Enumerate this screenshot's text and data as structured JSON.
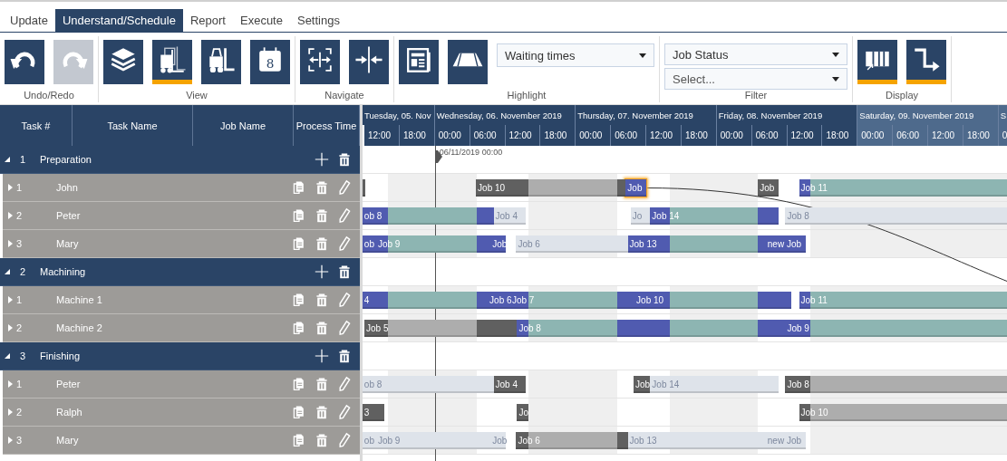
{
  "tabs": [
    {
      "label": "Update",
      "selected": false
    },
    {
      "label": "Understand/Schedule",
      "selected": true
    },
    {
      "label": "Report",
      "selected": false
    },
    {
      "label": "Execute",
      "selected": false
    },
    {
      "label": "Settings",
      "selected": false
    }
  ],
  "ribbon": [
    {
      "label": "Undo/Redo",
      "buttons": [
        {
          "selected": false,
          "disabled": false
        },
        {
          "selected": false,
          "disabled": true
        }
      ]
    },
    {
      "label": "View",
      "buttons": [
        {
          "selected": false,
          "disabled": false
        },
        {
          "selected": true,
          "disabled": false
        },
        {
          "selected": false,
          "disabled": false
        },
        {
          "selected": false,
          "disabled": false,
          "text": "8"
        }
      ]
    },
    {
      "label": "Navigate",
      "buttons": [
        {
          "selected": false,
          "disabled": false
        },
        {
          "selected": false,
          "disabled": false
        }
      ]
    },
    {
      "label": "Highlight",
      "buttons": [
        {
          "selected": false,
          "disabled": false
        },
        {
          "selected": false,
          "disabled": false
        }
      ],
      "dropdowns": [
        {
          "value": "Waiting times"
        }
      ]
    },
    {
      "label": "Filter",
      "dropdowns": [
        {
          "value": "Job Status"
        },
        {
          "placeholder": "Select..."
        }
      ]
    },
    {
      "label": "Display",
      "buttons": [
        {
          "selected": true,
          "disabled": false
        },
        {
          "selected": true,
          "disabled": false
        }
      ]
    }
  ],
  "columns": [
    "Task #",
    "Task Name",
    "Job Name",
    "Process Time"
  ],
  "timeline": {
    "days": [
      {
        "label": "Tuesday, 05. Nov",
        "weekend": false,
        "ticks": [
          "12:00",
          "18:00"
        ]
      },
      {
        "label": "Wednesday, 06. November 2019",
        "weekend": false,
        "ticks": [
          "00:00",
          "06:00",
          "12:00",
          "18:00"
        ]
      },
      {
        "label": "Thursday, 07. November 2019",
        "weekend": false,
        "ticks": [
          "00:00",
          "06:00",
          "12:00",
          "18:00"
        ]
      },
      {
        "label": "Friday, 08. November 2019",
        "weekend": false,
        "ticks": [
          "00:00",
          "06:00",
          "12:00",
          "18:00"
        ]
      },
      {
        "label": "Saturday, 09. November 2019",
        "weekend": true,
        "ticks": [
          "00:00",
          "06:00",
          "12:00",
          "18:00"
        ]
      },
      {
        "label": "S",
        "weekend": true,
        "ticks": [
          "0"
        ]
      }
    ],
    "now_marker": {
      "label": "06/11/2019 00:00"
    }
  },
  "groups": [
    {
      "number": "1",
      "name": "Preparation",
      "expanded": true,
      "children": [
        {
          "number": "1",
          "name": "John",
          "expanded": false,
          "bars": [
            {
              "selected": false,
              "segments": [
                {
                  "kind": "done-setup"
                }
              ]
            },
            {
              "label": "Job 10",
              "selected": false,
              "segments": [
                {
                  "kind": "done-setup"
                },
                {
                  "kind": "done-process"
                },
                {
                  "kind": "done-setup"
                }
              ]
            },
            {
              "label": "Job",
              "selected": true,
              "successor_link": true,
              "segments": [
                {
                  "kind": "setup"
                }
              ]
            },
            {
              "label": "Job",
              "selected": false,
              "segments": [
                {
                  "kind": "done-setup"
                }
              ]
            },
            {
              "label": "Job 11",
              "selected": false,
              "segments": [
                {
                  "kind": "setup"
                },
                {
                  "kind": "process"
                }
              ]
            }
          ]
        },
        {
          "number": "2",
          "name": "Peter",
          "expanded": false,
          "bars": [
            {
              "label": "ob 8",
              "selected": false,
              "segments": [
                {
                  "kind": "setup"
                },
                {
                  "kind": "process"
                },
                {
                  "kind": "setup"
                }
              ]
            },
            {
              "label": "Job 4",
              "selected": false,
              "segments": [
                {
                  "kind": "faded"
                }
              ]
            },
            {
              "label": "Jo",
              "selected": false,
              "segments": [
                {
                  "kind": "faded"
                }
              ]
            },
            {
              "label": "Job 14",
              "selected": false,
              "segments": [
                {
                  "kind": "setup"
                },
                {
                  "kind": "process"
                },
                {
                  "kind": "setup"
                }
              ]
            },
            {
              "label": "Job 8",
              "selected": false,
              "segments": [
                {
                  "kind": "faded"
                }
              ]
            }
          ]
        },
        {
          "number": "3",
          "name": "Mary",
          "expanded": false,
          "bars": [
            {
              "label": "ob",
              "selected": false,
              "segments": [
                {
                  "kind": "setup"
                }
              ]
            },
            {
              "label": "Job 9",
              "selected": false,
              "segments": [
                {
                  "kind": "setup"
                },
                {
                  "kind": "process"
                },
                {
                  "kind": "setup"
                }
              ]
            },
            {
              "label": "Job",
              "selected": false,
              "segments": [
                {
                  "kind": "setup"
                }
              ]
            },
            {
              "label": "Job 6",
              "selected": false,
              "segments": [
                {
                  "kind": "faded"
                }
              ]
            },
            {
              "label": "Job 13",
              "selected": false,
              "segments": [
                {
                  "kind": "setup"
                },
                {
                  "kind": "process"
                },
                {
                  "kind": "setup"
                }
              ]
            },
            {
              "label": "new Job",
              "selected": false,
              "segments": [
                {
                  "kind": "setup"
                }
              ]
            }
          ]
        }
      ]
    },
    {
      "number": "2",
      "name": "Machining",
      "expanded": true,
      "children": [
        {
          "number": "1",
          "name": "Machine 1",
          "expanded": false,
          "bars": [
            {
              "label": "4",
              "selected": false,
              "segments": [
                {
                  "kind": "setup"
                },
                {
                  "kind": "process"
                },
                {
                  "kind": "setup"
                }
              ]
            },
            {
              "label": "Job 6",
              "selected": false,
              "segments": [
                {
                  "kind": "setup"
                }
              ]
            },
            {
              "label": "Job 7",
              "selected": false,
              "segments": [
                {
                  "kind": "setup"
                },
                {
                  "kind": "process"
                },
                {
                  "kind": "setup"
                }
              ]
            },
            {
              "label": "Job 10",
              "selected": false,
              "segments": [
                {
                  "kind": "setup"
                },
                {
                  "kind": "process"
                },
                {
                  "kind": "setup"
                }
              ]
            },
            {
              "label": "Job 11",
              "selected": false,
              "segments": [
                {
                  "kind": "setup"
                },
                {
                  "kind": "process"
                }
              ]
            }
          ]
        },
        {
          "number": "2",
          "name": "Machine 2",
          "expanded": false,
          "bars": [
            {
              "label": "Job 5",
              "selected": false,
              "segments": [
                {
                  "kind": "done-setup"
                },
                {
                  "kind": "done-process"
                },
                {
                  "kind": "done-setup"
                }
              ]
            },
            {
              "label": "Job 8",
              "selected": false,
              "segments": [
                {
                  "kind": "setup"
                },
                {
                  "kind": "process"
                },
                {
                  "kind": "setup"
                },
                {
                  "kind": "process"
                },
                {
                  "kind": "setup"
                }
              ]
            },
            {
              "label": "Job 9",
              "selected": false,
              "segments": [
                {
                  "kind": "setup"
                },
                {
                  "kind": "process"
                }
              ]
            }
          ]
        }
      ]
    },
    {
      "number": "3",
      "name": "Finishing",
      "expanded": true,
      "children": [
        {
          "number": "1",
          "name": "Peter",
          "expanded": false,
          "bars": [
            {
              "label": "ob 8",
              "selected": false,
              "segments": [
                {
                  "kind": "faded"
                }
              ]
            },
            {
              "label": "Job 4",
              "selected": false,
              "segments": [
                {
                  "kind": "done-setup"
                }
              ]
            },
            {
              "label": "Job",
              "selected": false,
              "segments": [
                {
                  "kind": "done-setup"
                }
              ]
            },
            {
              "label": "Job 14",
              "selected": false,
              "segments": [
                {
                  "kind": "faded"
                }
              ]
            },
            {
              "label": "Job 8",
              "selected": false,
              "segments": [
                {
                  "kind": "done-setup"
                },
                {
                  "kind": "done-process"
                }
              ]
            }
          ]
        },
        {
          "number": "2",
          "name": "Ralph",
          "expanded": false,
          "bars": [
            {
              "label": "3",
              "selected": false,
              "segments": [
                {
                  "kind": "done-setup"
                }
              ]
            },
            {
              "label": "Jo",
              "selected": false,
              "segments": [
                {
                  "kind": "done-setup"
                }
              ]
            },
            {
              "label": "Job 10",
              "selected": false,
              "segments": [
                {
                  "kind": "done-setup"
                },
                {
                  "kind": "done-process"
                }
              ]
            }
          ]
        },
        {
          "number": "3",
          "name": "Mary",
          "expanded": false,
          "bars": [
            {
              "label": "ob",
              "selected": false,
              "segments": [
                {
                  "kind": "faded"
                }
              ]
            },
            {
              "label": "Job 9",
              "selected": false,
              "segments": [
                {
                  "kind": "faded"
                }
              ]
            },
            {
              "label": "Job",
              "selected": false,
              "segments": [
                {
                  "kind": "faded"
                }
              ]
            },
            {
              "label": "Job 6",
              "selected": false,
              "segments": [
                {
                  "kind": "done-setup"
                },
                {
                  "kind": "done-process"
                },
                {
                  "kind": "done-setup"
                }
              ]
            },
            {
              "label": "Job 13",
              "selected": false,
              "segments": [
                {
                  "kind": "faded"
                }
              ]
            },
            {
              "label": "new Job",
              "selected": false,
              "segments": [
                {
                  "kind": "faded"
                }
              ]
            }
          ]
        }
      ]
    }
  ]
}
